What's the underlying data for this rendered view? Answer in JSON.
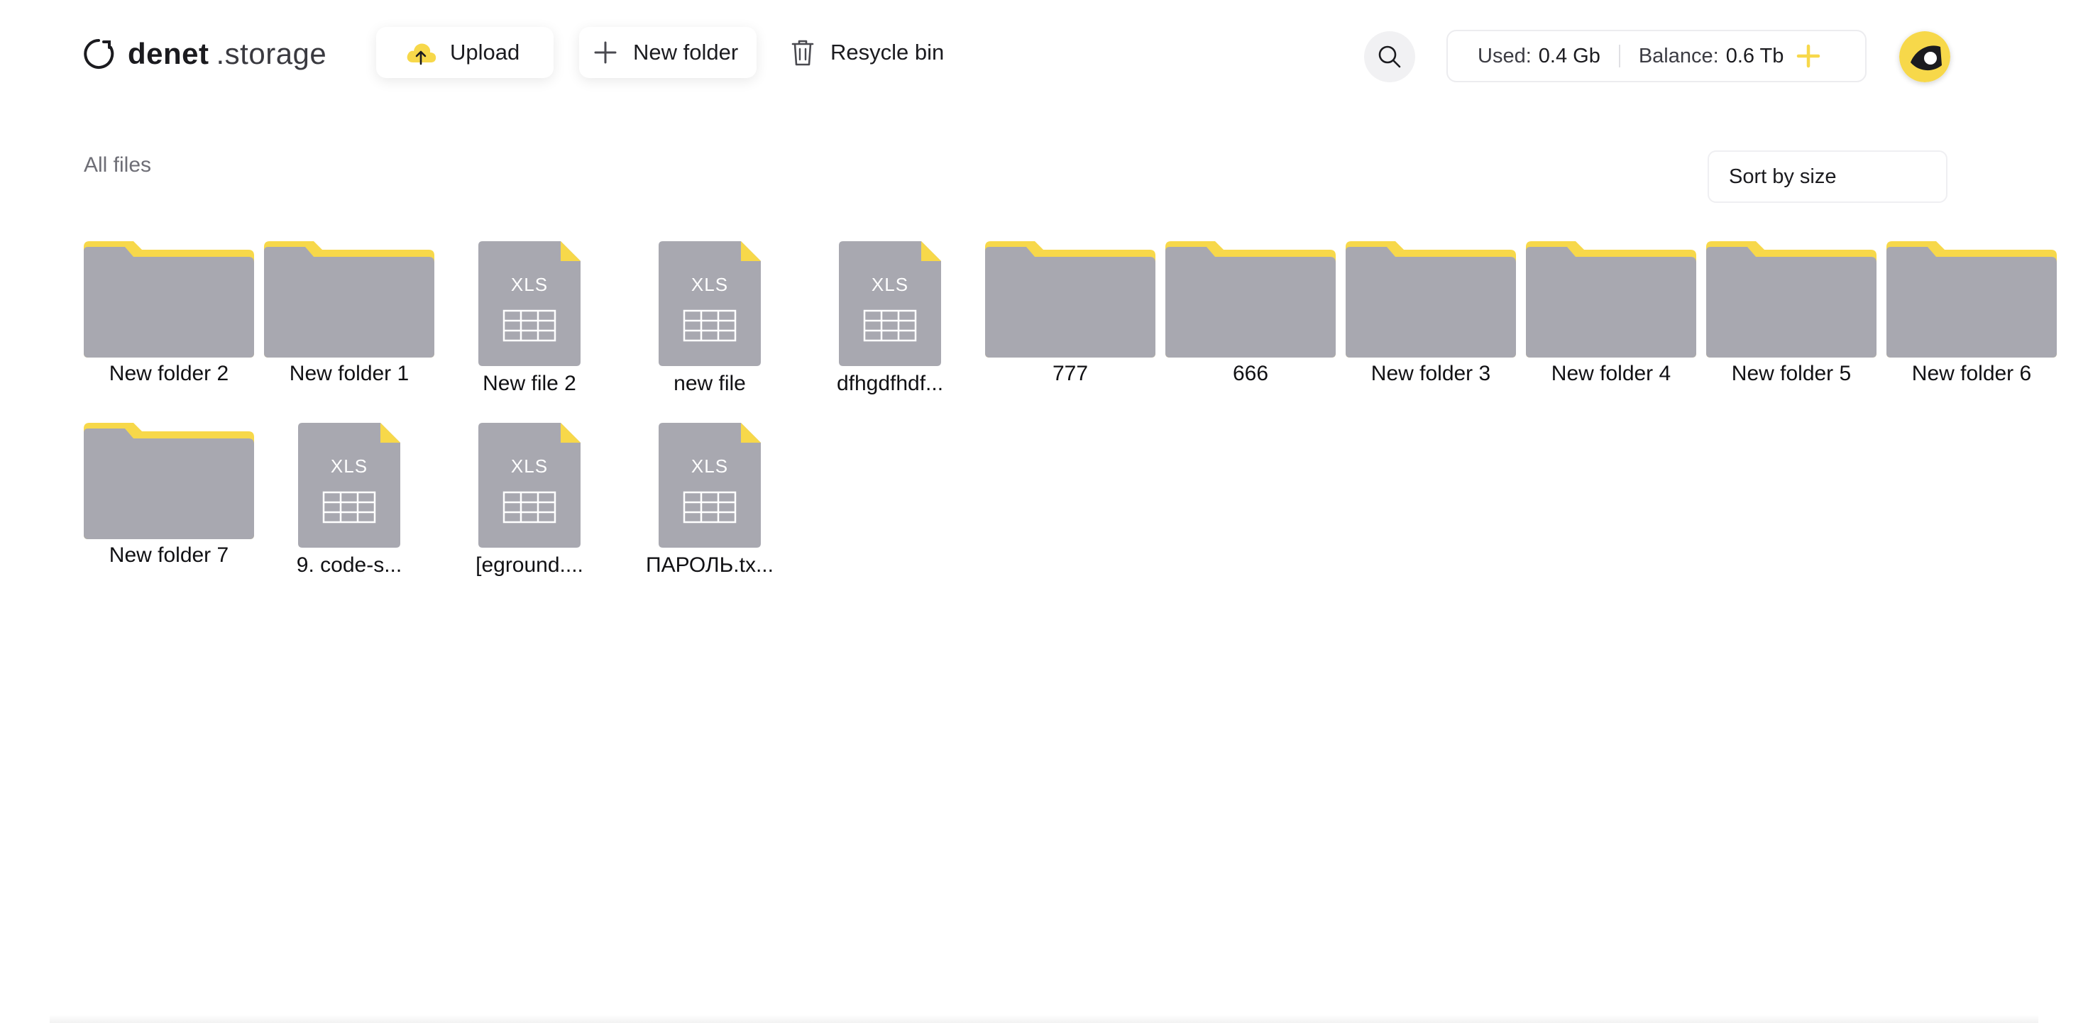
{
  "brand": {
    "logo_main": "denet",
    "logo_suffix": ".storage"
  },
  "header": {
    "upload_label": "Upload",
    "new_folder_label": "New folder",
    "recycle_label": "Resycle bin",
    "used_label": "Used:",
    "used_value": "0.4 Gb",
    "balance_label": "Balance:",
    "balance_value": "0.6 Tb"
  },
  "toolbar": {
    "breadcrumb": "All files",
    "sort_label": "Sort by size"
  },
  "items": [
    {
      "type": "folder",
      "name": "New folder 2"
    },
    {
      "type": "folder",
      "name": "New folder 1"
    },
    {
      "type": "file",
      "badge": "XLS",
      "name": "New file 2"
    },
    {
      "type": "file",
      "badge": "XLS",
      "name": "new file"
    },
    {
      "type": "file",
      "badge": "XLS",
      "name": "dfhgdfhdf..."
    },
    {
      "type": "folder",
      "name": "777"
    },
    {
      "type": "folder",
      "name": "666"
    },
    {
      "type": "folder",
      "name": "New folder 3"
    },
    {
      "type": "folder",
      "name": "New folder 4"
    },
    {
      "type": "folder",
      "name": "New folder 5"
    },
    {
      "type": "folder",
      "name": "New folder 6"
    },
    {
      "type": "folder",
      "name": "New folder 7"
    },
    {
      "type": "file",
      "badge": "XLS",
      "name": "9. code-s..."
    },
    {
      "type": "file",
      "badge": "XLS",
      "name": "[eground...."
    },
    {
      "type": "file",
      "badge": "XLS",
      "name": "ПАРОЛЬ.tx..."
    }
  ],
  "colors": {
    "accent": "#F7D84A",
    "thumb_gray": "#A8A8B0",
    "text": "#1B1B1F"
  },
  "icons": [
    "logo-ring-icon",
    "cloud-upload-icon",
    "plus-icon",
    "trash-icon",
    "search-icon",
    "plus-yellow-icon",
    "avatar",
    "folder-icon",
    "xls-file-icon"
  ]
}
